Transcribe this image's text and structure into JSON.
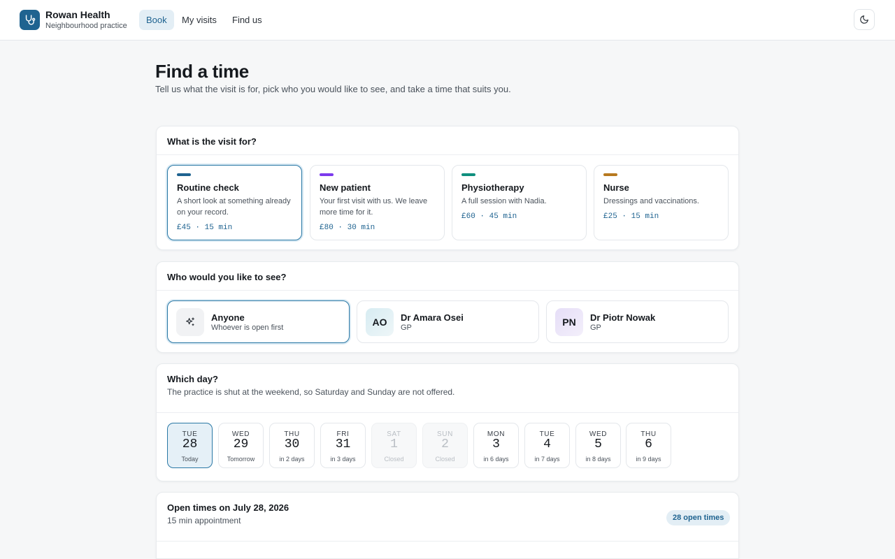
{
  "header": {
    "brand_name": "Rowan Health",
    "brand_sub": "Neighbourhood practice",
    "nav": [
      "Book",
      "My visits",
      "Find us"
    ],
    "active_nav": "Book"
  },
  "page": {
    "title": "Find a time",
    "lede": "Tell us what the visit is for, pick who you would like to see, and take a time that suits you."
  },
  "visit": {
    "heading": "What is the visit for?",
    "types": [
      {
        "name": "Routine check",
        "desc": "A short look at something already on your record.",
        "meta": "£45 · 15 min",
        "color": "#1f6390",
        "selected": true
      },
      {
        "name": "New patient",
        "desc": "Your first visit with us. We leave more time for it.",
        "meta": "£80 · 30 min",
        "color": "#7c3aed",
        "selected": false
      },
      {
        "name": "Physiotherapy",
        "desc": "A full session with Nadia.",
        "meta": "£60 · 45 min",
        "color": "#0f8f7e",
        "selected": false
      },
      {
        "name": "Nurse",
        "desc": "Dressings and vaccinations.",
        "meta": "£25 · 15 min",
        "color": "#b7791f",
        "selected": false
      }
    ]
  },
  "clinician": {
    "heading": "Who would you like to see?",
    "options": [
      {
        "name": "Anyone",
        "role": "Whoever is open first",
        "initials": "",
        "icon": "sparkle-icon",
        "selected": true
      },
      {
        "name": "Dr Amara Osei",
        "role": "GP",
        "initials": "AO",
        "selected": false
      },
      {
        "name": "Dr Piotr Nowak",
        "role": "GP",
        "initials": "PN",
        "selected": false
      }
    ]
  },
  "days": {
    "heading": "Which day?",
    "desc": "The practice is shut at the weekend, so Saturday and Sunday are not offered.",
    "items": [
      {
        "dow": "TUE",
        "num": "28",
        "rel": "Today",
        "state": "selected"
      },
      {
        "dow": "WED",
        "num": "29",
        "rel": "Tomorrow",
        "state": "open"
      },
      {
        "dow": "THU",
        "num": "30",
        "rel": "in 2 days",
        "state": "open"
      },
      {
        "dow": "FRI",
        "num": "31",
        "rel": "in 3 days",
        "state": "open"
      },
      {
        "dow": "SAT",
        "num": "1",
        "rel": "Closed",
        "state": "closed"
      },
      {
        "dow": "SUN",
        "num": "2",
        "rel": "Closed",
        "state": "closed"
      },
      {
        "dow": "MON",
        "num": "3",
        "rel": "in 6 days",
        "state": "open"
      },
      {
        "dow": "TUE",
        "num": "4",
        "rel": "in 7 days",
        "state": "open"
      },
      {
        "dow": "WED",
        "num": "5",
        "rel": "in 8 days",
        "state": "open"
      },
      {
        "dow": "THU",
        "num": "6",
        "rel": "in 9 days",
        "state": "open"
      }
    ]
  },
  "times": {
    "heading": "Open times on July 28, 2026",
    "sub": "15 min appointment",
    "badge": "28 open times"
  },
  "colors": {
    "accent": "#1f6390",
    "accent_soft": "#e3eef5"
  }
}
